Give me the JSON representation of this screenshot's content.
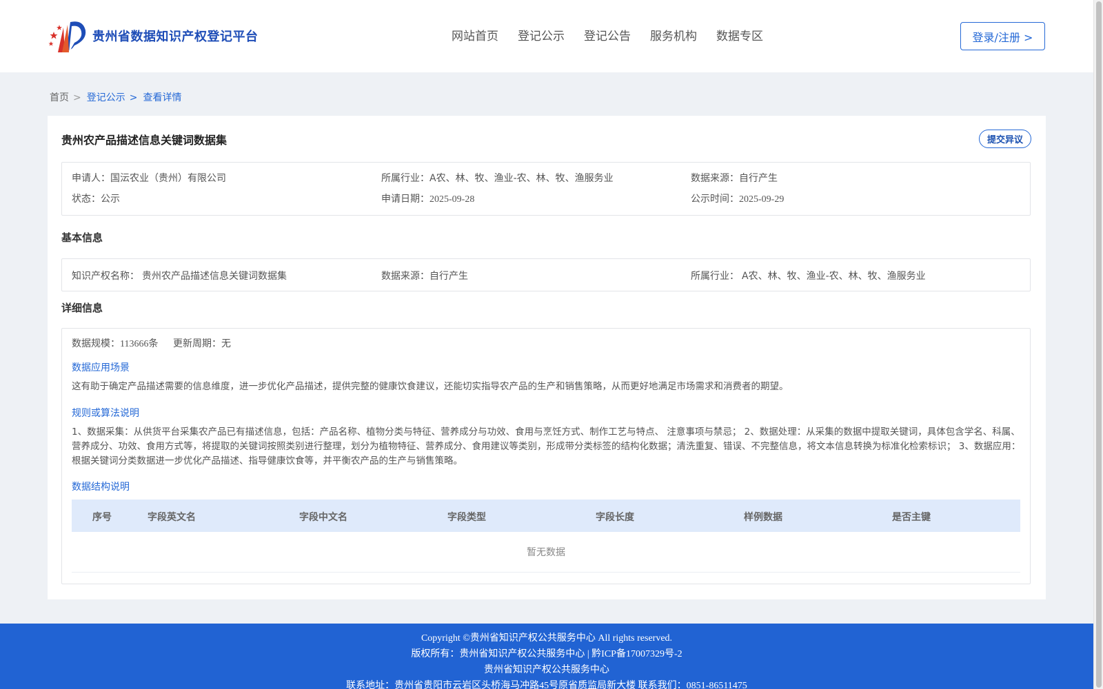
{
  "header": {
    "logo_text": "贵州省数据知识产权登记平台",
    "nav": [
      "网站首页",
      "登记公示",
      "登记公告",
      "服务机构",
      "数据专区"
    ],
    "login_label": "登录/注册 >"
  },
  "breadcrumb": {
    "home": "首页",
    "sep": ">",
    "level1": "登记公示",
    "current": "查看详情"
  },
  "detail": {
    "title": "贵州农产品描述信息关键词数据集",
    "objection_label": "提交异议",
    "summary": {
      "applicant_label": "申请人：",
      "applicant": "国沄农业（贵州）有限公司",
      "industry_label": "所属行业：",
      "industry": "A农、林、牧、渔业-农、林、牧、渔服务业",
      "source_label": "数据来源：",
      "source": "自行产生",
      "status_label": "状态：",
      "status": "公示",
      "apply_date_label": "申请日期：",
      "apply_date": "2025-09-28",
      "publish_date_label": "公示时间：",
      "publish_date": "2025-09-29"
    },
    "basic": {
      "heading": "基本信息",
      "ip_name_label": "知识产权名称：",
      "ip_name": "贵州农产品描述信息关键词数据集",
      "source_label": "数据来源：",
      "source": "自行产生",
      "industry_label": "所属行业：",
      "industry": "A农、林、牧、渔业-农、林、牧、渔服务业"
    },
    "more": {
      "heading": "详细信息",
      "scale_label": "数据规模：",
      "scale": "113666条",
      "cycle_label": "更新周期：",
      "cycle": "无",
      "scene_heading": "数据应用场景",
      "scene_text": "这有助于确定产品描述需要的信息维度，进一步优化产品描述，提供完整的健康饮食建议，还能切实指导农产品的生产和销售策略，从而更好地满足市场需求和消费者的期望。",
      "algo_heading": "规则或算法说明",
      "algo_text": "1、数据采集：从供货平台采集农产品已有描述信息，包括：产品名称、植物分类与特征、营养成分与功效、食用与烹饪方式、制作工艺与特点、 注意事项与禁忌； 2、数据处理：从采集的数据中提取关键词，具体包含学名、科属、营养成分、功效、食用方式等，将提取的关键词按照类别进行整理，划分为植物特征、营养成分、食用建议等类别，形成带分类标签的结构化数据；清洗重复、错误、不完整信息，将文本信息转换为标准化检索标识； 3、数据应用：根据关键词分类数据进一步优化产品描述、指导健康饮食等，并平衡农产品的生产与销售策略。",
      "struct_heading": "数据结构说明",
      "table_headers": [
        "序号",
        "字段英文名",
        "字段中文名",
        "字段类型",
        "字段长度",
        "样例数据",
        "是否主键"
      ],
      "empty_text": "暂无数据"
    }
  },
  "footer": {
    "copyright": "Copyright ©贵州省知识产权公共服务中心 All rights reserved.",
    "owner": "版权所有：贵州省知识产权公共服务中心 | 黔ICP备17007329号-2",
    "org": "贵州省知识产权公共服务中心",
    "contact": "联系地址：贵州省贵阳市云岩区头桥海马冲路45号原省质监局新大楼 联系我们：0851-86511475"
  },
  "colors": {
    "primary": "#2468d6",
    "footer_bg": "#2163d3",
    "table_head_bg": "#dfeafb"
  }
}
